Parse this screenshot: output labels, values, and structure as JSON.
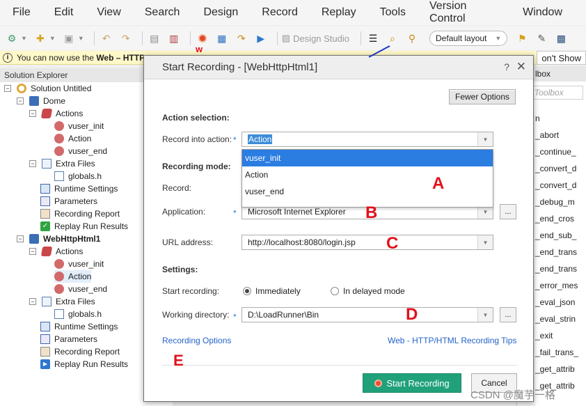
{
  "menu": [
    "File",
    "Edit",
    "View",
    "Search",
    "Design",
    "Record",
    "Replay",
    "Tools",
    "Version Control",
    "Window"
  ],
  "toolbar": {
    "design_studio_label": "Design Studio",
    "layout_select_value": "Default layout"
  },
  "infobar": {
    "prefix": "You can now use the ",
    "bold": "Web – HTTP",
    "dont_show": "on't Show"
  },
  "solution_explorer": {
    "header": "Solution Explorer",
    "items": [
      {
        "label": "Solution Untitled",
        "icon": "solution-icon"
      },
      {
        "label": "Dome",
        "icon": "script-icon"
      },
      {
        "label": "Actions",
        "icon": "actions-icon"
      },
      {
        "label": "vuser_init",
        "icon": "action-icon"
      },
      {
        "label": "Action",
        "icon": "action-icon"
      },
      {
        "label": "vuser_end",
        "icon": "action-icon"
      },
      {
        "label": "Extra Files",
        "icon": "folder-icon"
      },
      {
        "label": "globals.h",
        "icon": "file-icon"
      },
      {
        "label": "Runtime Settings",
        "icon": "settings-icon"
      },
      {
        "label": "Parameters",
        "icon": "parameters-icon"
      },
      {
        "label": "Recording Report",
        "icon": "report-icon"
      },
      {
        "label": "Replay Run Results",
        "icon": "check-icon"
      },
      {
        "label": "WebHttpHtml1",
        "icon": "script-icon"
      },
      {
        "label": "Actions",
        "icon": "actions-icon"
      },
      {
        "label": "vuser_init",
        "icon": "action-icon"
      },
      {
        "label": "Action",
        "icon": "action-icon"
      },
      {
        "label": "vuser_end",
        "icon": "action-icon"
      },
      {
        "label": "Extra Files",
        "icon": "folder-icon"
      },
      {
        "label": "globals.h",
        "icon": "file-icon"
      },
      {
        "label": "Runtime Settings",
        "icon": "settings-icon"
      },
      {
        "label": "Parameters",
        "icon": "parameters-icon"
      },
      {
        "label": "Recording Report",
        "icon": "report-icon"
      },
      {
        "label": "Replay Run Results",
        "icon": "play-icon"
      }
    ]
  },
  "toolbox": {
    "header": "lbox",
    "search_placeholder": "Toolbox",
    "items": [
      "n",
      "_abort",
      "_continue_",
      "_convert_d",
      "_convert_d",
      "_debug_m",
      "_end_cros",
      "_end_sub_",
      "_end_trans",
      "_end_trans",
      "_error_mes",
      "_eval_json",
      "_eval_strin",
      "_exit",
      "_fail_trans_",
      "_get_attrib",
      "_get_attrib"
    ]
  },
  "dialog": {
    "title": "Start Recording - [WebHttpHtml1]",
    "help": "?",
    "close": "✕",
    "fewer_options": "Fewer Options",
    "action_selection_heading": "Action selection:",
    "record_into_label": "Record into action:",
    "record_into_value": "Action",
    "dropdown_options": [
      "vuser_init",
      "Action",
      "vuser_end"
    ],
    "dropdown_selected_index": 0,
    "recording_mode_heading": "Recording mode:",
    "record_label": "Record:",
    "application_label": "Application:",
    "application_value": "Microsoft Internet Explorer",
    "url_label": "URL address:",
    "url_value": "http://localhost:8080/login.jsp",
    "settings_heading": "Settings:",
    "start_recording_label": "Start recording:",
    "radio_immediately": "Immediately",
    "radio_delayed": "In delayed mode",
    "radio_selected": "Immediately",
    "working_dir_label": "Working directory:",
    "working_dir_value": "D:\\LoadRunner\\Bin",
    "browse_label": "...",
    "recording_options_link": "Recording Options",
    "tips_link": "Web - HTTP/HTML Recording Tips",
    "start_button": "Start Recording",
    "cancel_button": "Cancel"
  },
  "annotations": {
    "w": "w",
    "a": "A",
    "b": "B",
    "c": "C",
    "d": "D",
    "e": "E"
  },
  "watermark": "CSDN @魔芋一格"
}
